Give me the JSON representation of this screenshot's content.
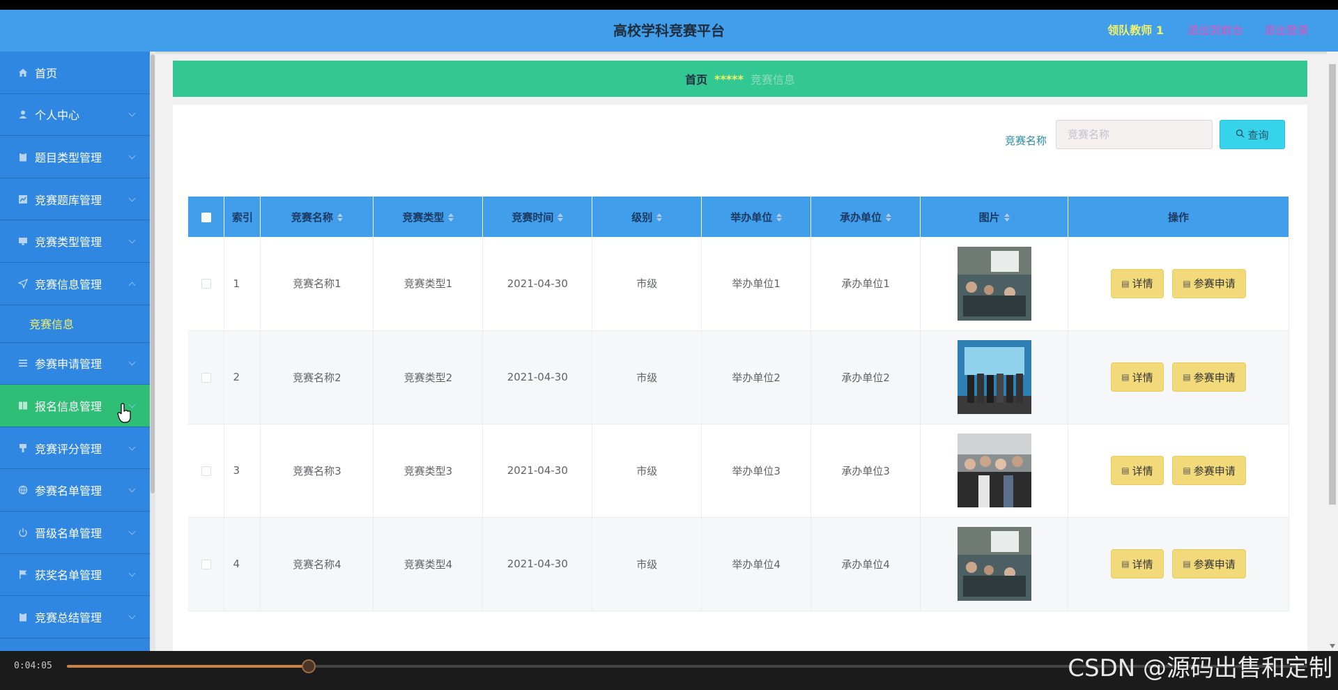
{
  "header": {
    "title": "高校学科竞赛平台",
    "user": "领队教师 1",
    "to_front": "退出到前台",
    "logout": "退出登录"
  },
  "sidebar": {
    "items": [
      {
        "label": "首页",
        "icon": "home-icon",
        "has_children": false
      },
      {
        "label": "个人中心",
        "icon": "user-icon",
        "has_children": true
      },
      {
        "label": "题目类型管理",
        "icon": "clipboard-icon",
        "has_children": true
      },
      {
        "label": "竞赛题库管理",
        "icon": "chart-icon",
        "has_children": true
      },
      {
        "label": "竞赛类型管理",
        "icon": "monitor-icon",
        "has_children": true
      },
      {
        "label": "竞赛信息管理",
        "icon": "send-icon",
        "has_children": true,
        "expanded": true
      },
      {
        "label": "参赛申请管理",
        "icon": "list-icon",
        "has_children": true
      },
      {
        "label": "报名信息管理",
        "icon": "book-icon",
        "has_children": true,
        "active": true
      },
      {
        "label": "竞赛评分管理",
        "icon": "brush-icon",
        "has_children": true
      },
      {
        "label": "参赛名单管理",
        "icon": "globe-icon",
        "has_children": true
      },
      {
        "label": "晋级名单管理",
        "icon": "power-icon",
        "has_children": true
      },
      {
        "label": "获奖名单管理",
        "icon": "flag-icon",
        "has_children": true
      },
      {
        "label": "竞赛总结管理",
        "icon": "clipboard-icon",
        "has_children": true
      }
    ],
    "sub_item": "竞赛信息"
  },
  "breadcrumb": {
    "home": "首页",
    "separator": "*****",
    "current": "竞赛信息"
  },
  "search": {
    "label": "竞赛名称",
    "placeholder": "竞赛名称",
    "button": "查询"
  },
  "table": {
    "headers": [
      "索引",
      "竞赛名称",
      "竞赛类型",
      "竞赛时间",
      "级别",
      "举办单位",
      "承办单位",
      "图片",
      "操作"
    ],
    "rows": [
      {
        "index": "1",
        "name": "竞赛名称1",
        "type": "竞赛类型1",
        "time": "2021-04-30",
        "level": "市级",
        "host": "举办单位1",
        "organizer": "承办单位1"
      },
      {
        "index": "2",
        "name": "竞赛名称2",
        "type": "竞赛类型2",
        "time": "2021-04-30",
        "level": "市级",
        "host": "举办单位2",
        "organizer": "承办单位2"
      },
      {
        "index": "3",
        "name": "竞赛名称3",
        "type": "竞赛类型3",
        "time": "2021-04-30",
        "level": "市级",
        "host": "举办单位3",
        "organizer": "承办单位3"
      },
      {
        "index": "4",
        "name": "竞赛名称4",
        "type": "竞赛类型4",
        "time": "2021-04-30",
        "level": "市级",
        "host": "举办单位4",
        "organizer": "承办单位4"
      }
    ],
    "detail_button": "详情",
    "apply_button": "参赛申请"
  },
  "video": {
    "time": "0:04:05",
    "progress": 0.195,
    "watermark": "CSDN @源码出售和定制"
  },
  "colors": {
    "header": "#409eea",
    "sidebar": "#2f87e1",
    "active": "#2fbe76",
    "breadcrumb": "#32c793",
    "button": "#f2da7a",
    "search": "#37d3ea"
  }
}
